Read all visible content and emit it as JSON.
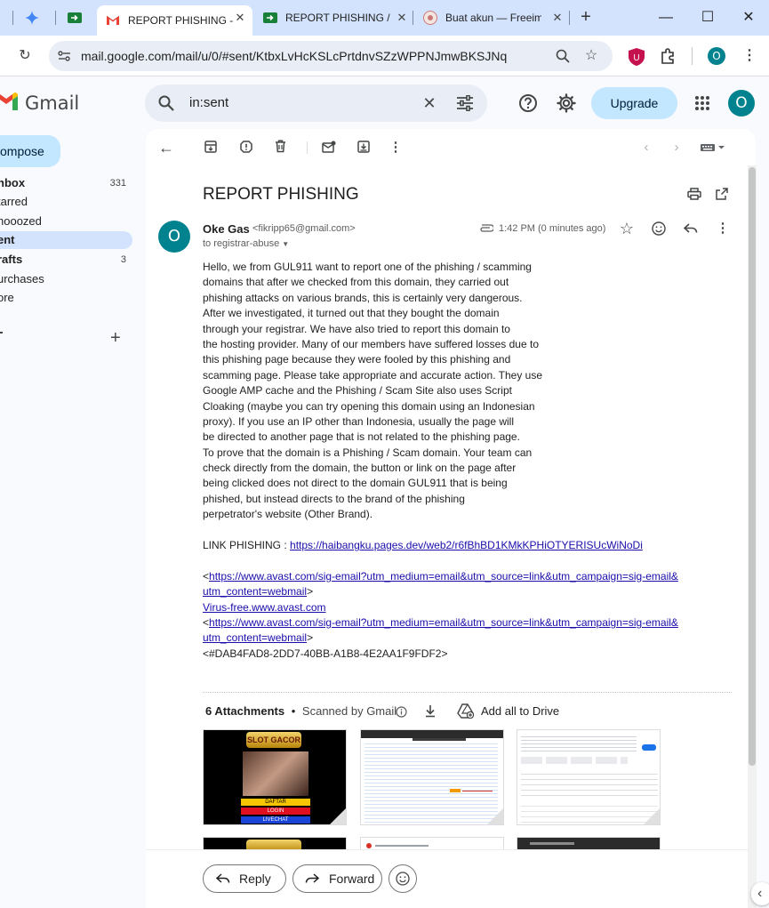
{
  "browser": {
    "tabs": [
      {
        "label": "REPORT PHISHING -",
        "favicon": "gmail-icon",
        "active": true
      },
      {
        "label": "REPORT PHISHING /",
        "favicon": "meet-icon",
        "active": false
      },
      {
        "label": "Buat akun — Freeim",
        "favicon": "freeimage-icon",
        "active": false
      }
    ],
    "url": "mail.google.com/mail/u/0/#sent/KtbxLvHcKSLcPrtdnvSZzWPPNJmwBKSJNq",
    "profile_initial": "O"
  },
  "header": {
    "app_name": "Gmail",
    "search_value": "in:sent",
    "upgrade_label": "Upgrade",
    "avatar_initial": "O"
  },
  "sidebar": {
    "compose_label": "ompose",
    "items": [
      {
        "label": "nbox",
        "count": "331"
      },
      {
        "label": "tarred",
        "count": ""
      },
      {
        "label": "nooozed",
        "count": ""
      },
      {
        "label": "ent",
        "count": ""
      },
      {
        "label": "rafts",
        "count": "3"
      },
      {
        "label": "urchases",
        "count": ""
      },
      {
        "label": "ore",
        "count": ""
      }
    ],
    "labels_add": "+"
  },
  "message": {
    "subject": "REPORT PHISHING",
    "sender_initial": "O",
    "sender_name": "Oke Gas",
    "sender_email": "<fikripp65@gmail.com>",
    "to": "to registrar-abuse",
    "time": "1:42 PM (0 minutes ago)",
    "body_lines": [
      "Hello, we from GUL911 want to report one of the phishing / scamming",
      "domains that after we checked from this domain, they carried out",
      "phishing attacks on various brands, this is certainly very dangerous.",
      "After we investigated, it turned out that they bought the domain",
      "through your registrar. We have also tried to report this domain to",
      "the hosting provider. Many of our members have suffered losses due to",
      "this phishing page because they were fooled by this phishing and",
      "scamming page. Please take appropriate and accurate action. They use",
      "Google AMP cache and the Phishing / Scam Site also uses Script",
      "Cloaking (maybe you can try opening this domain using an Indonesian",
      "proxy). If you use an IP other than Indonesia, usually the page will",
      "be directed to another page that is not related to the phishing page.",
      "To prove that the domain is a Phishing / Scam domain. Your team can",
      "check directly from the domain, the button or link on the page after",
      "being clicked does not direct to the domain GUL911 that is being",
      "phished, but instead directs to the brand of the phishing",
      "perpetrator's website (Other Brand)."
    ],
    "link_label": "LINK PHISHING : ",
    "link_url": "https://haibangku.pages.dev/web2/r6fBhBD1KMkKPHiOTYERISUcWiNoDi",
    "avast_link_1a": "https://www.avast.com/sig-email?utm_medium=email&utm_source=link&utm_campaign=sig-email&",
    "avast_link_1b": "utm_content=webmail",
    "virus_free": "Virus-free.www.avast.com",
    "avast_link_2a": "https://www.avast.com/sig-email?utm_medium=email&utm_source=link&utm_campaign=sig-email&",
    "avast_link_2b": "utm_content=webmail",
    "lt": "<",
    "gt": ">",
    "signature_id": "<#DAB4FAD8-2DD7-40BB-A1B8-4E2AA1F9FDF2>"
  },
  "attachments": {
    "count_label": "6 Attachments",
    "dot": "•",
    "scanned_label": "Scanned by Gmail",
    "add_all_label": "Add all to Drive",
    "thumb1": {
      "banner": "SLOT GACOR",
      "buttons": [
        "DAFTAR",
        "LOGIN",
        "LIVECHAT"
      ]
    }
  },
  "actions": {
    "reply_label": "Reply",
    "forward_label": "Forward"
  },
  "colors": {
    "accent": "#0b57d0",
    "upgrade_bg": "#c2e7ff",
    "avatar_bg": "#00838f",
    "active_nav_bg": "#d3e3fd",
    "link": "#1a0dab"
  }
}
